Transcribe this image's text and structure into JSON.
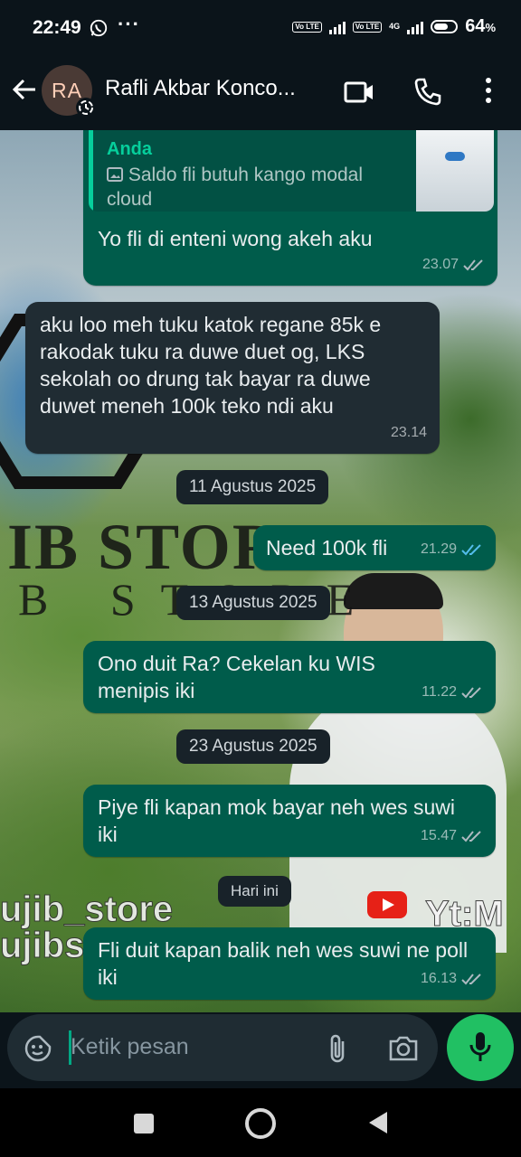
{
  "status_bar": {
    "time": "22:49",
    "more": "···",
    "volte": "Vo LTE",
    "network": "4G",
    "battery": "64",
    "battery_unit": "%"
  },
  "header": {
    "avatar_initials": "RA",
    "contact_name": "Rafli Akbar Konco..."
  },
  "watermark": {
    "line1": "IB STORE",
    "line2": "B STORE",
    "line3": "ujib_store",
    "line4": "ujibs",
    "line5": "Yt:M"
  },
  "messages": [
    {
      "quote_author": "Anda",
      "quote_text": "Saldo fli butuh kango modal cloud",
      "text": "Yo fli di enteni wong akeh aku",
      "time": "23.07"
    },
    {
      "text": "aku loo meh tuku katok regane 85k e rakodak tuku ra duwe duet og, LKS sekolah oo drung tak bayar ra duwe duwet meneh 100k teko ndi aku",
      "time": "23.14"
    },
    {
      "date": "11 Agustus 2025"
    },
    {
      "text": "Need 100k fli",
      "time": "21.29"
    },
    {
      "date": "13 Agustus 2025"
    },
    {
      "text": "Ono duit Ra? Cekelan ku WIS menipis iki",
      "time": "11.22"
    },
    {
      "date": "23 Agustus 2025"
    },
    {
      "text": "Piye fli kapan mok bayar neh wes suwi iki",
      "time": "15.47"
    },
    {
      "date": "Hari ini"
    },
    {
      "text": "Fli duit kapan balik neh wes suwi ne poll iki",
      "time": "16.13"
    }
  ],
  "input": {
    "placeholder": "Ketik pesan"
  },
  "colors": {
    "outgoing_bubble": "#005c4b",
    "incoming_bubble": "#202c33",
    "accent": "#21c063",
    "read_tick": "#53bdeb"
  }
}
